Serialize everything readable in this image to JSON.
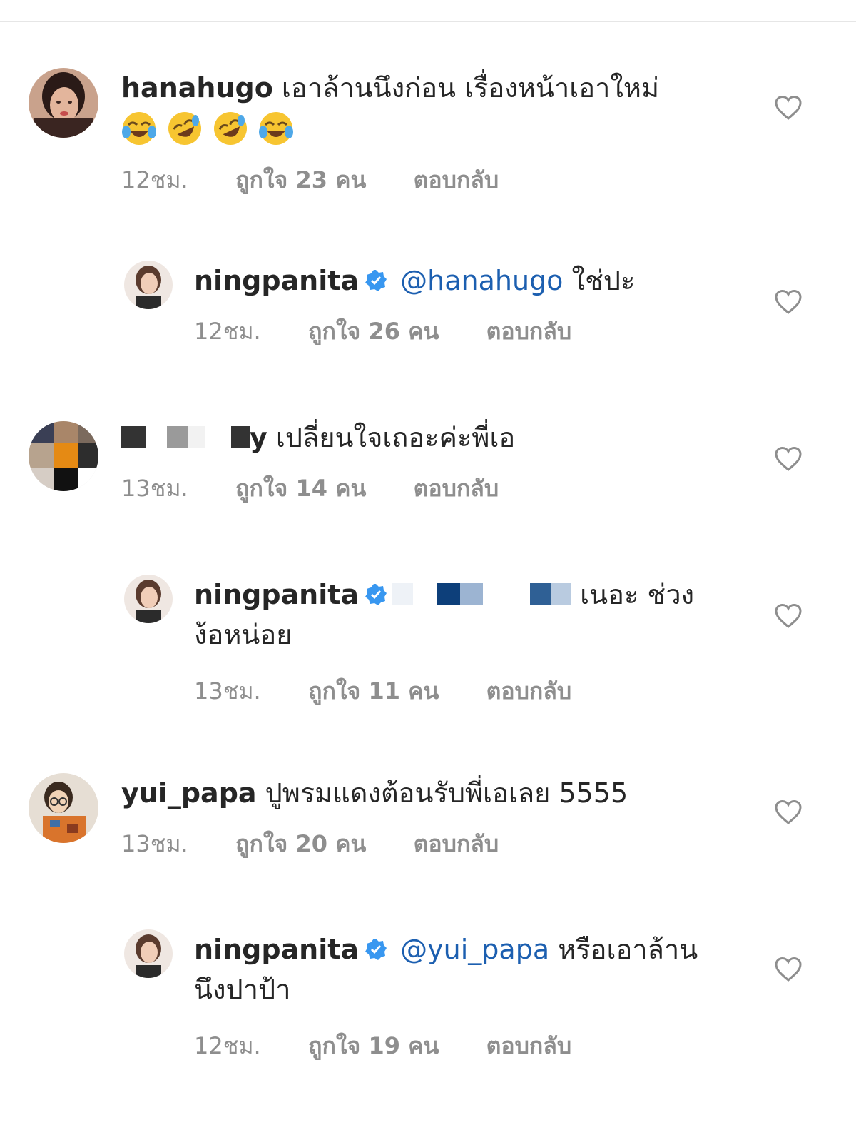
{
  "icons": {
    "heart": "heart-outline-icon",
    "verified": "verified-badge-icon"
  },
  "colors": {
    "mention": "#1c5fb0",
    "meta": "#8e8e8e",
    "verified": "#3897f0"
  },
  "comments": [
    {
      "username": "hanahugo",
      "text": "เอาล้านนึงก่อน เรื่องหน้าเอาใหม่",
      "emojis": [
        "joy",
        "rofl",
        "rofl",
        "joy"
      ],
      "time": "12ชม.",
      "likes": "ถูกใจ 23 คน",
      "reply": "ตอบกลับ"
    },
    {
      "username": "ningpanita",
      "mention": "@hanahugo",
      "text": "ใช่ปะ",
      "time": "12ชม.",
      "likes": "ถูกใจ 26 คน",
      "reply": "ตอบกลับ"
    },
    {
      "username_tail": "y",
      "text": "เปลี่ยนใจเถอะค่ะพี่เอ",
      "time": "13ชม.",
      "likes": "ถูกใจ 14 คน",
      "reply": "ตอบกลับ"
    },
    {
      "username": "ningpanita",
      "text": "เนอะ ช่วง",
      "text2": "ง้อหน่อย",
      "time": "13ชม.",
      "likes": "ถูกใจ 11 คน",
      "reply": "ตอบกลับ"
    },
    {
      "username": "yui_papa",
      "text": "ปูพรมแดงต้อนรับพี่เอเลย 5555",
      "time": "13ชม.",
      "likes": "ถูกใจ 20 คน",
      "reply": "ตอบกลับ"
    },
    {
      "username": "ningpanita",
      "mention": "@yui_papa",
      "text": "หรือเอาล้าน",
      "text2": "นึงปาป้า",
      "time": "12ชม.",
      "likes": "ถูกใจ 19 คน",
      "reply": "ตอบกลับ"
    }
  ]
}
